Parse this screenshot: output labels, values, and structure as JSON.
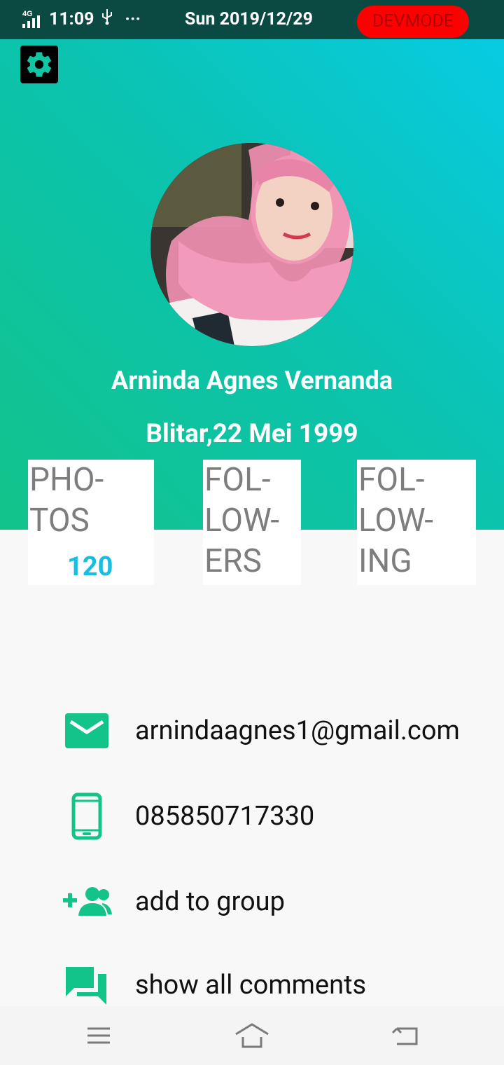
{
  "status_bar": {
    "network": "4G",
    "time": "11:09",
    "usb_icon": "usb-icon",
    "more": "···",
    "date": "Sun 2019/12/29",
    "devmode": "DEVMODE"
  },
  "header": {
    "settings_icon": "gear-icon",
    "name": "Arninda Agnes Vernanda",
    "birth": "Blitar,22 Mei 1999"
  },
  "stats": {
    "photos_label": "PHO-\nTOS",
    "photos_count": "120",
    "followers_label": "FOL-\nLOW-\nERS",
    "following_label": "FOL-\nLOW-\nING"
  },
  "info": {
    "email": "arnindaagnes1@gmail.com",
    "phone": "085850717330",
    "add_group": "add to group",
    "comments": "show all comments"
  },
  "colors": {
    "accent_green": "#12c38a",
    "accent_cyan": "#08cbe3",
    "count_blue": "#19bde0",
    "devmode_red": "#ff0000"
  }
}
